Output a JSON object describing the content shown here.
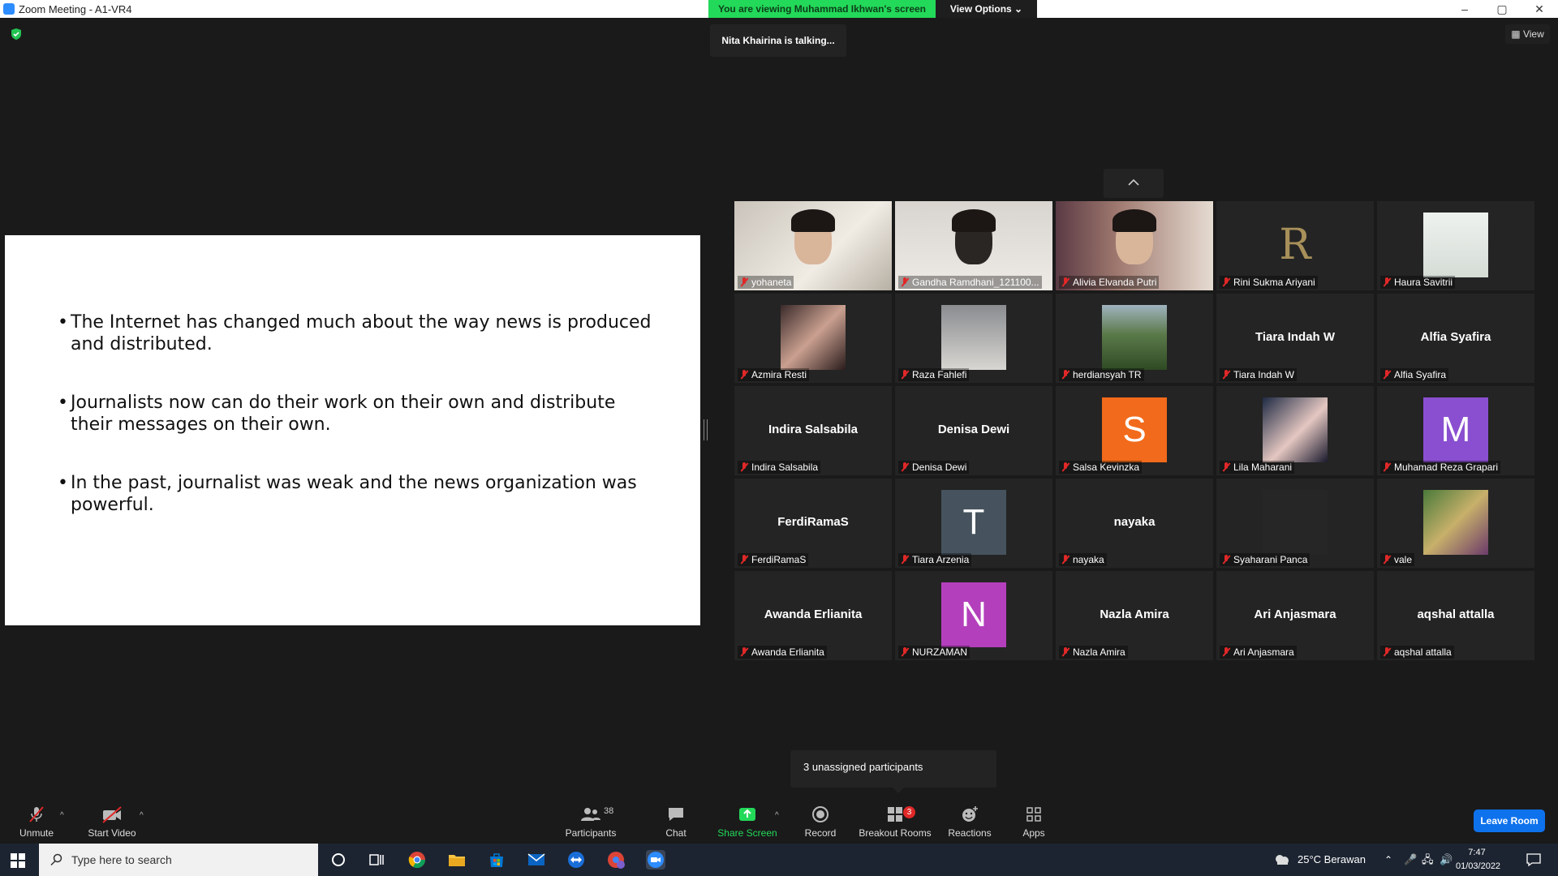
{
  "window": {
    "title": "Zoom Meeting - A1-VR4",
    "controls": [
      "–",
      "▢",
      "✕"
    ]
  },
  "share_banner": {
    "text": "You are viewing Muhammad Ikhwan's screen",
    "view_options": "View Options ⌄",
    "talking": "Nita Khairina is talking..."
  },
  "view_button": "View",
  "slide": {
    "bullets": [
      "The Internet has changed much about the way news is produced and distributed.",
      "Journalists now can do their work on their own and distribute their messages on their own.",
      "In the past, journalist was weak and the news organization was powerful."
    ]
  },
  "participants_tiles": [
    {
      "label": "yohaneta",
      "big": "",
      "type": "video"
    },
    {
      "label": "Gandha Ramdhani_121100...",
      "big": "",
      "type": "video"
    },
    {
      "label": "Alivia Elvanda Putri",
      "big": "",
      "type": "video"
    },
    {
      "label": "Rini Sukma Ariyani",
      "big": "",
      "type": "photo-r"
    },
    {
      "label": "Haura Savitrii",
      "big": "",
      "type": "photo"
    },
    {
      "label": "Azmira Resti",
      "big": "",
      "type": "photo"
    },
    {
      "label": "Raza Fahlefi",
      "big": "",
      "type": "photo"
    },
    {
      "label": "herdiansyah TR",
      "big": "",
      "type": "photo-landscape"
    },
    {
      "label": "Tiara Indah W",
      "big": "Tiara Indah W",
      "type": "name"
    },
    {
      "label": "Alfia Syafira",
      "big": "Alfia Syafira",
      "type": "name"
    },
    {
      "label": "Indira Salsabila",
      "big": "Indira Salsabila",
      "type": "name"
    },
    {
      "label": "Denisa Dewi",
      "big": "Denisa Dewi",
      "type": "name"
    },
    {
      "label": "Salsa Kevinzka",
      "big": "",
      "type": "avatar",
      "letter": "S",
      "color": "#f26a1b"
    },
    {
      "label": "Lila Maharani",
      "big": "",
      "type": "photo"
    },
    {
      "label": "Muhamad Reza Grapari",
      "big": "",
      "type": "avatar",
      "letter": "M",
      "color": "#8a4fd0"
    },
    {
      "label": "FerdiRamaS",
      "big": "FerdiRamaS",
      "type": "name"
    },
    {
      "label": "Tiara Arzenia",
      "big": "",
      "type": "avatar",
      "letter": "T",
      "color": "#46535e"
    },
    {
      "label": "nayaka",
      "big": "nayaka",
      "type": "name"
    },
    {
      "label": "Syaharani Panca",
      "big": "",
      "type": "dark"
    },
    {
      "label": "vale",
      "big": "",
      "type": "photo-cartoon"
    },
    {
      "label": "Awanda Erlianita",
      "big": "Awanda Erlianita",
      "type": "name"
    },
    {
      "label": "NURZAMAN",
      "big": "",
      "type": "avatar",
      "letter": "N",
      "color": "#b43fbc"
    },
    {
      "label": "Nazla Amira",
      "big": "Nazla Amira",
      "type": "name"
    },
    {
      "label": "Ari Anjasmara",
      "big": "Ari Anjasmara",
      "type": "name"
    },
    {
      "label": "aqshal attalla",
      "big": "aqshal attalla",
      "type": "name"
    }
  ],
  "toast": "3 unassigned participants",
  "toolbar": {
    "unmute": "Unmute",
    "start_video": "Start Video",
    "participants": "Participants",
    "participants_count": "38",
    "chat": "Chat",
    "share_screen": "Share Screen",
    "record": "Record",
    "breakout_rooms": "Breakout Rooms",
    "breakout_badge": "3",
    "reactions": "Reactions",
    "apps": "Apps",
    "leave_room": "Leave Room"
  },
  "taskbar": {
    "search_placeholder": "Type here to search",
    "weather": "25°C  Berawan",
    "time": "7:47",
    "date": "01/03/2022"
  },
  "colors": {
    "share_green": "#23d959",
    "leave_blue": "#0e72ed",
    "mute_red": "#e02828"
  }
}
